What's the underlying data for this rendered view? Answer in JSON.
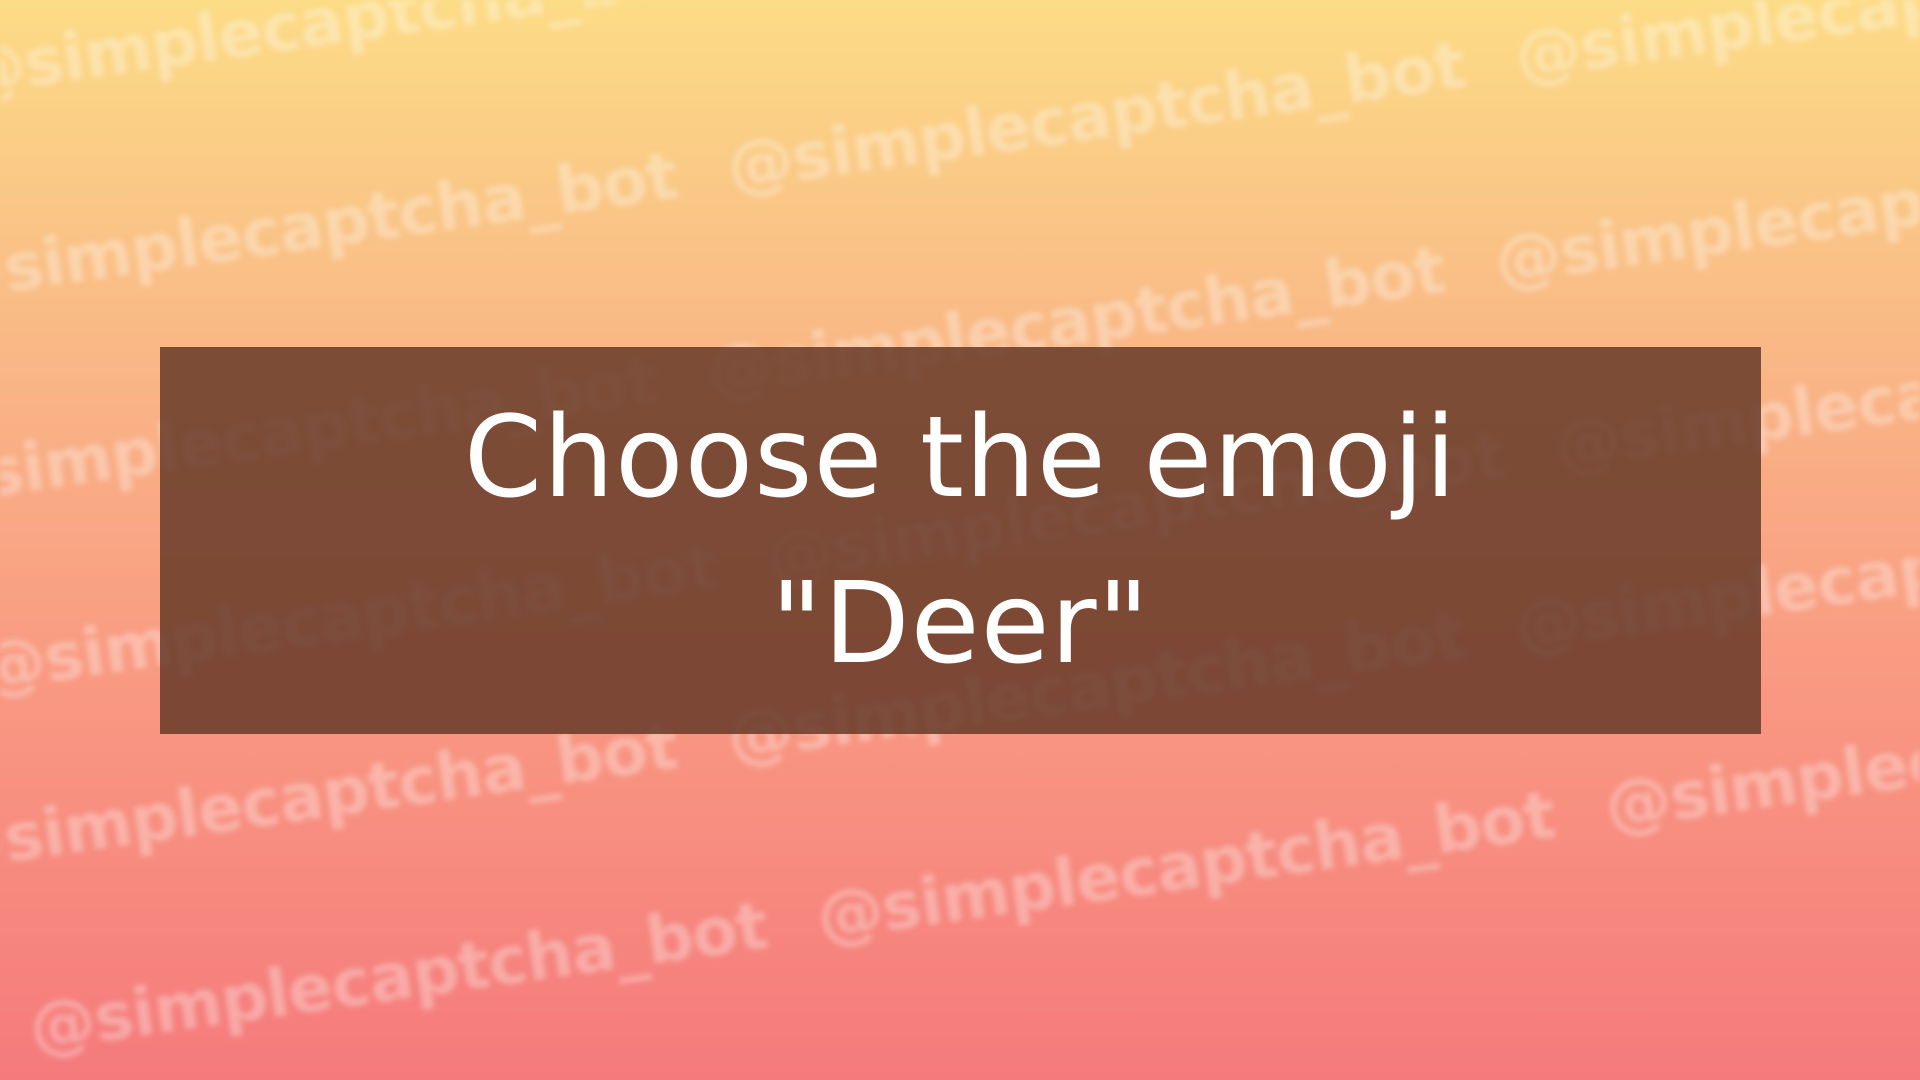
{
  "watermark": {
    "text": "@simplecaptcha_bot"
  },
  "captcha": {
    "instruction_line": "Choose the emoji",
    "target_line": "\"Deer\""
  }
}
